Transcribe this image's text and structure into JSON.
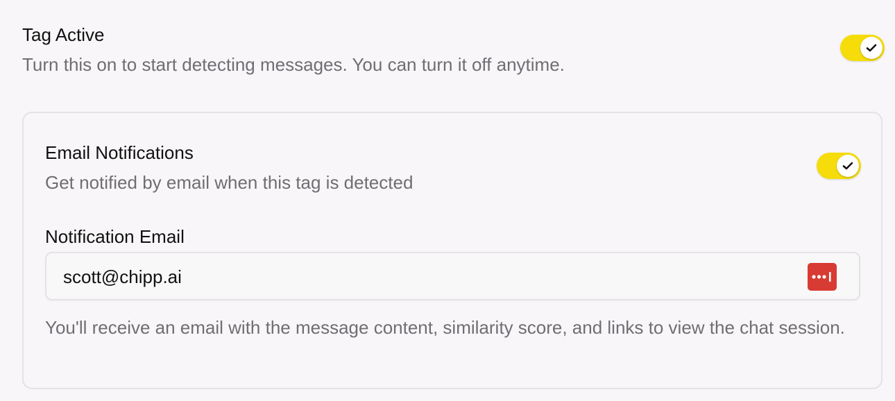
{
  "tag_active": {
    "title": "Tag Active",
    "description": "Turn this on to start detecting messages. You can turn it off anytime.",
    "enabled": true,
    "toggle_icon": "check-icon"
  },
  "email_notifications": {
    "title": "Email Notifications",
    "description": "Get notified by email when this tag is detected",
    "enabled": true,
    "toggle_icon": "check-icon"
  },
  "notification_email": {
    "label": "Notification Email",
    "value": "scott@chipp.ai",
    "autofill_icon": "lastpass-icon",
    "helper_text": "You'll receive an email with the message content, similarity score, and links to view the chat session."
  },
  "colors": {
    "toggle_on": "#f5dc0a",
    "autofill_icon_bg": "#d83b33",
    "muted_text": "#6e6e73"
  }
}
